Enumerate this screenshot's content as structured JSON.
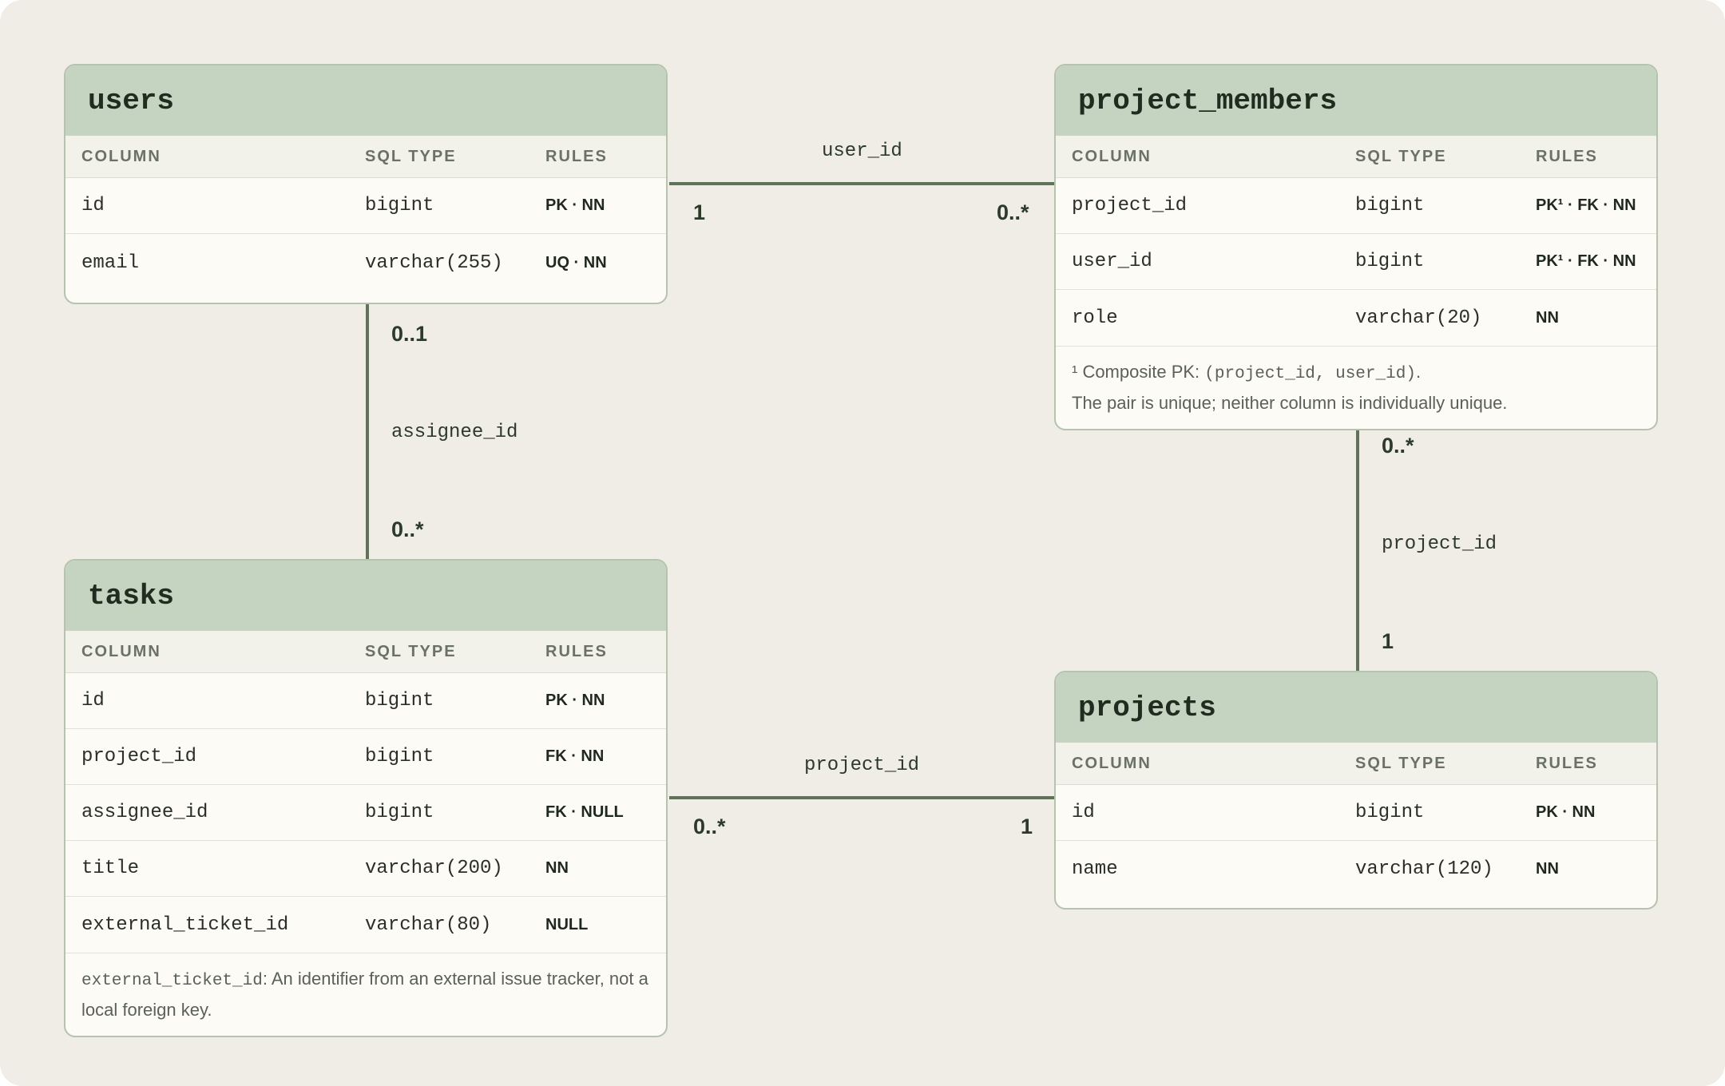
{
  "colors": {
    "canvas": "#efede5",
    "header": "#c5d4c0",
    "connector": "#5f7358"
  },
  "column_headers": {
    "column": "COLUMN",
    "type": "SQL TYPE",
    "rules": "RULES"
  },
  "tables": {
    "users": {
      "name": "users",
      "rows": [
        {
          "column": "id",
          "type": "bigint",
          "rules": "PK · NN"
        },
        {
          "column": "email",
          "type": "varchar(255)",
          "rules": "UQ · NN"
        }
      ]
    },
    "project_members": {
      "name": "project_members",
      "rows": [
        {
          "column": "project_id",
          "type": "bigint",
          "rules": "PK¹ · FK · NN"
        },
        {
          "column": "user_id",
          "type": "bigint",
          "rules": "PK¹ · FK · NN"
        },
        {
          "column": "role",
          "type": "varchar(20)",
          "rules": "NN"
        }
      ],
      "note": {
        "line1_prefix": "¹ Composite PK: ",
        "line1_code": "(project_id, user_id)",
        "line1_suffix": ".",
        "line2": "The pair is unique; neither column is individually unique."
      }
    },
    "tasks": {
      "name": "tasks",
      "rows": [
        {
          "column": "id",
          "type": "bigint",
          "rules": "PK · NN"
        },
        {
          "column": "project_id",
          "type": "bigint",
          "rules": "FK · NN"
        },
        {
          "column": "assignee_id",
          "type": "bigint",
          "rules": "FK · NULL"
        },
        {
          "column": "title",
          "type": "varchar(200)",
          "rules": "NN"
        },
        {
          "column": "external_ticket_id",
          "type": "varchar(80)",
          "rules": "NULL"
        }
      ],
      "note": {
        "code": "external_ticket_id",
        "text": ": An identifier from an external issue tracker, not a local foreign key."
      }
    },
    "projects": {
      "name": "projects",
      "rows": [
        {
          "column": "id",
          "type": "bigint",
          "rules": "PK · NN"
        },
        {
          "column": "name",
          "type": "varchar(120)",
          "rules": "NN"
        }
      ]
    }
  },
  "relationships": {
    "users_members": {
      "label": "user_id",
      "from_card": "1",
      "to_card": "0..*"
    },
    "users_tasks": {
      "label": "assignee_id",
      "from_card": "0..1",
      "to_card": "0..*"
    },
    "members_projects": {
      "label": "project_id",
      "from_card": "0..*",
      "to_card": "1"
    },
    "tasks_projects": {
      "label": "project_id",
      "from_card": "0..*",
      "to_card": "1"
    }
  }
}
